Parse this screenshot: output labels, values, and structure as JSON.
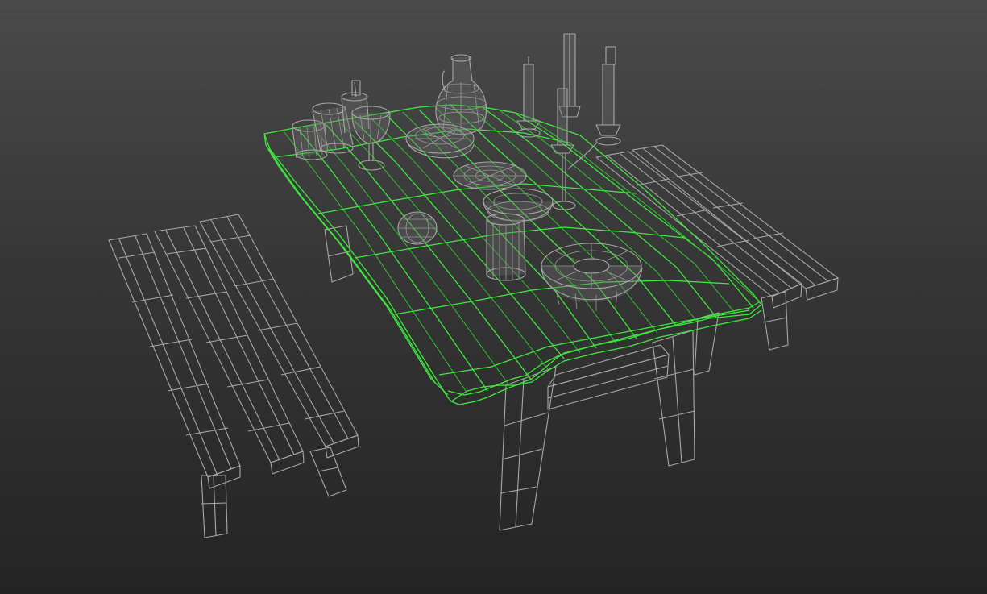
{
  "viewport": {
    "background_top": "#4a4a4a",
    "background_bottom": "#242424",
    "wireframe_color": "#a8a8a8",
    "selection_color": "#3ee83e",
    "selected_object": "table-top"
  }
}
